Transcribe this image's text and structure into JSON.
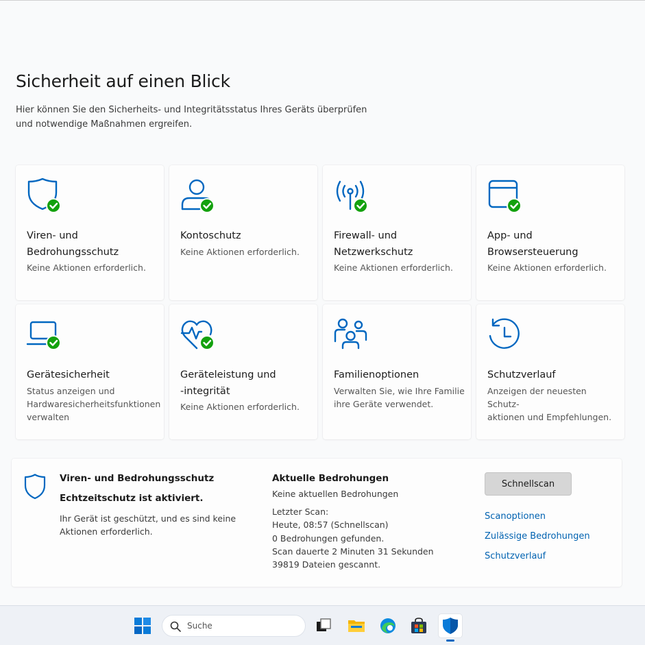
{
  "page": {
    "title": "Sicherheit auf einen Blick",
    "subtitle_line1": "Hier können Sie den Sicherheits- und Integritätsstatus Ihres Geräts überprüfen",
    "subtitle_line2": "und notwendige Maßnahmen ergreifen."
  },
  "colors": {
    "accent": "#0067c0",
    "ok": "#13a10e",
    "link": "#0062b1"
  },
  "tiles": [
    {
      "icon": "shield-check-icon",
      "title1": "Viren- und",
      "title2": "Bedrohungsschutz",
      "status1": "Keine Aktionen erforderlich."
    },
    {
      "icon": "account-check-icon",
      "title1": "Kontoschutz",
      "status1": "Keine Aktionen erforderlich."
    },
    {
      "icon": "wifi-antenna-check-icon",
      "title1": "Firewall- und",
      "title2": "Netzwerkschutz",
      "status1": "Keine Aktionen erforderlich."
    },
    {
      "icon": "browser-window-check-icon",
      "title1": "App- und",
      "title2": "Browsersteuerung",
      "status1": "Keine Aktionen erforderlich."
    },
    {
      "icon": "laptop-check-icon",
      "title1": "Gerätesicherheit",
      "status1": "Status anzeigen und",
      "status2": "Hardwaresicherheitsfunktionen",
      "status3": "verwalten"
    },
    {
      "icon": "heart-pulse-check-icon",
      "title1": "Geräteleistung und",
      "title2": "-integrität",
      "status1": "Keine Aktionen erforderlich."
    },
    {
      "icon": "family-icon",
      "title1": "Familienoptionen",
      "status1": "Verwalten Sie, wie Ihre Familie",
      "status2": "ihre Geräte verwendet."
    },
    {
      "icon": "history-clock-icon",
      "title1": "Schutzverlauf",
      "status1": "Anzeigen der neuesten Schutz-",
      "status2": "aktionen und Empfehlungen."
    }
  ],
  "panel": {
    "title": "Viren- und Bedrohungsschutz",
    "subtitle": "Echtzeitschutz ist aktiviert.",
    "desc_line1": "Ihr Gerät ist geschützt, und es sind keine",
    "desc_line2": "Aktionen erforderlich.",
    "threats_title": "Aktuelle Bedrohungen",
    "threats_none": "Keine aktuellen Bedrohungen",
    "scan_lines": [
      "Letzter Scan:",
      "Heute, 08:57 (Schnellscan)",
      "0 Bedrohungen gefunden.",
      "Scan dauerte 2 Minuten 31 Sekunden",
      "39819 Dateien gescannt."
    ],
    "scan_button": "Schnellscan",
    "links": [
      "Scanoptionen",
      "Zulässige Bedrohungen",
      "Schutzverlauf"
    ]
  },
  "taskbar": {
    "search_placeholder": "Suche",
    "items": [
      "windows-start-icon",
      "task-view-icon",
      "file-explorer-icon",
      "edge-browser-icon",
      "store-icon",
      "windows-security-icon"
    ]
  }
}
